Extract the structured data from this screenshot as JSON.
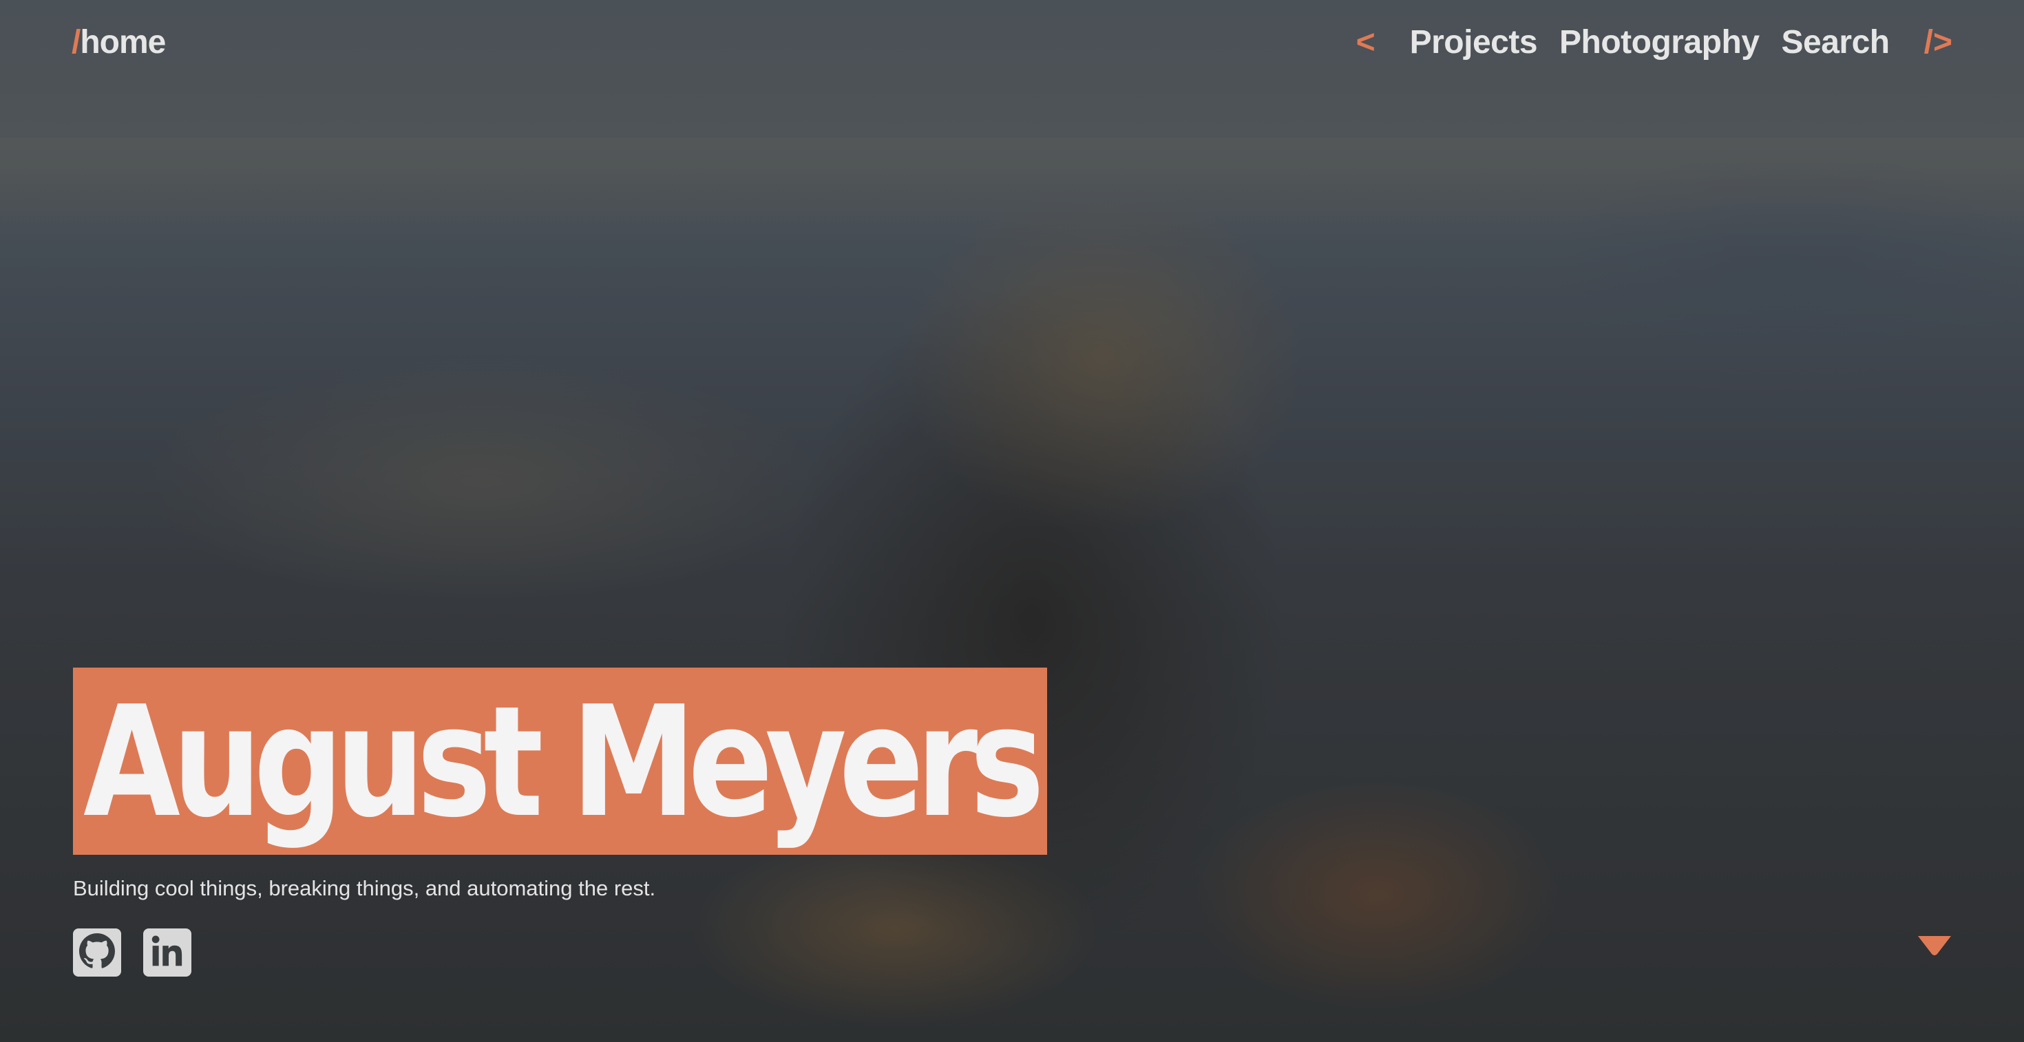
{
  "nav": {
    "home_slash": "/",
    "home_label": "home",
    "open_bracket": "<",
    "links": [
      "Projects",
      "Photography",
      "Search"
    ],
    "close_bracket": "/>"
  },
  "hero": {
    "name": "August Meyers",
    "tagline": "Building cool things, breaking things, and automating the rest."
  },
  "socials": {
    "github_icon": "github-icon",
    "linkedin_icon": "linkedin-icon"
  },
  "colors": {
    "accent": "#dd7a56",
    "text": "#e6e6e6",
    "social_bg": "#d8d8d8"
  },
  "scroll_icon": "caret-down-icon"
}
